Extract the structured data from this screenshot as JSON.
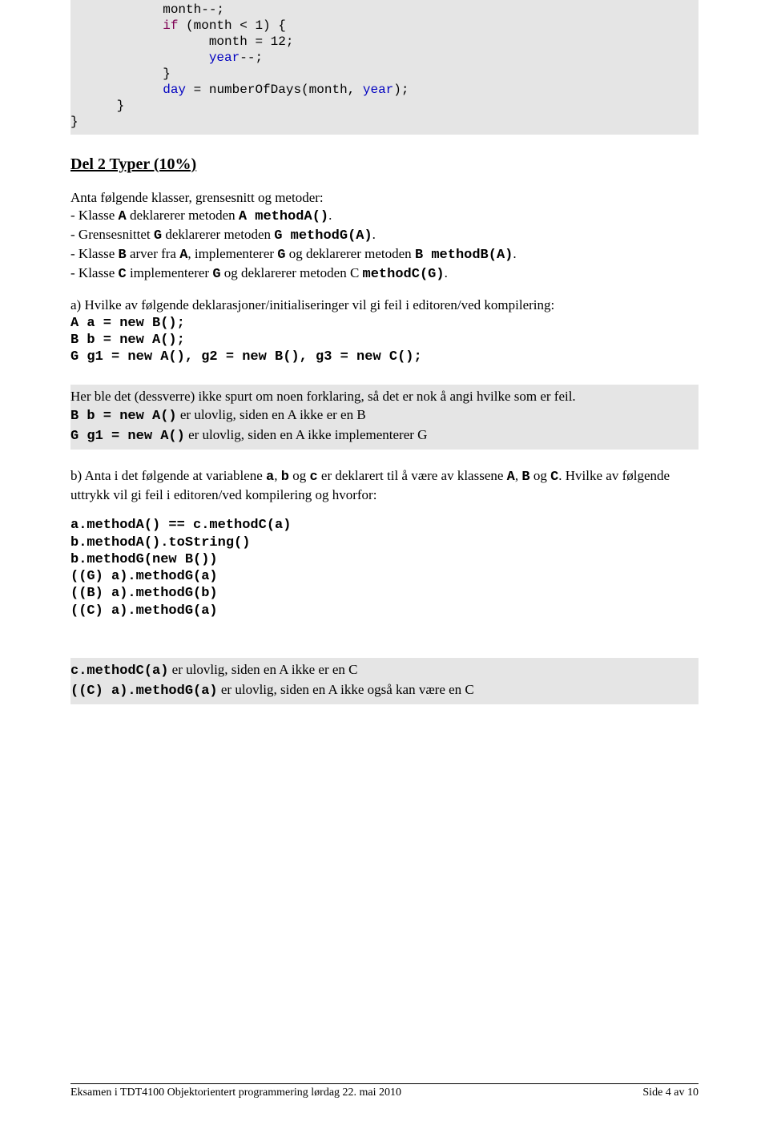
{
  "code": {
    "raw": "            month--;\n            if (month < 1) {\n                  month = 12;\n                  year--;\n            }\n            day = numberOfDays(month, year);\n      }\n}"
  },
  "section": {
    "heading": "Del 2 Typer (10%)",
    "intro": "Anta følgende klasser, grensesnitt og metoder:",
    "bullets": {
      "b1_pre": "- Klasse ",
      "b1_A": "A",
      "b1_mid": " deklarerer metoden ",
      "b1_m": "A methodA()",
      "b1_dot": ".",
      "b2_pre": "- Grensesnittet ",
      "b2_G": "G",
      "b2_mid": " deklarerer metoden ",
      "b2_m": "G methodG(A)",
      "b2_dot": ".",
      "b3_pre": "- Klasse ",
      "b3_B": "B",
      "b3_mid1": " arver fra ",
      "b3_A": "A",
      "b3_mid2": ", implementerer ",
      "b3_G": "G",
      "b3_mid3": " og deklarerer metoden ",
      "b3_m": "B methodB(A)",
      "b3_dot": ".",
      "b4_pre": "- Klasse ",
      "b4_C": "C",
      "b4_mid1": " implementerer ",
      "b4_G": "G",
      "b4_mid2": " og deklarerer metoden C ",
      "b4_m": "methodC(G)",
      "b4_dot": "."
    },
    "qa": {
      "text": "a) Hvilke av følgende deklarasjoner/initialiseringer vil gi feil i editoren/ved kompilering:",
      "code": "A a = new B();\nB b = new A();\nG g1 = new A(), g2 = new B(), g3 = new C();"
    },
    "answer_a": {
      "l1": "Her ble det (dessverre) ikke spurt om noen forklaring, så det er nok å angi hvilke som er feil.",
      "l2_code": "B b = new A()",
      "l2_text": "  er ulovlig, siden en A ikke er en B",
      "l3_code": "G g1 = new A()",
      "l3_text": " er ulovlig, siden en A ikke implementerer G"
    },
    "qb": {
      "pre": "b) Anta i det følgende at variablene ",
      "a": "a",
      "comma1": ", ",
      "b": "b",
      "mid1": " og ",
      "c": "c",
      "mid2": " er deklarert til å være av klassene ",
      "A": "A",
      "comma2": ", ",
      "B": "B",
      "mid3": " og ",
      "C": "C",
      "post": ". Hvilke av følgende uttrykk vil gi feil i editoren/ved kompilering og hvorfor:",
      "code": "a.methodA() == c.methodC(a)\nb.methodA().toString()\nb.methodG(new B())\n((G) a).methodG(a)\n((B) a).methodG(b)\n((C) a).methodG(a)"
    },
    "answer_b": {
      "l1_code": "c.methodC(a)",
      "l1_text": " er ulovlig, siden en A ikke er en C",
      "l2_code": "((C) a).methodG(a)",
      "l2_text": " er ulovlig, siden en A ikke også kan være en C"
    }
  },
  "footer": {
    "left": "Eksamen i TDT4100 Objektorientert programmering lørdag 22. mai 2010",
    "right": "Side 4 av 10"
  }
}
